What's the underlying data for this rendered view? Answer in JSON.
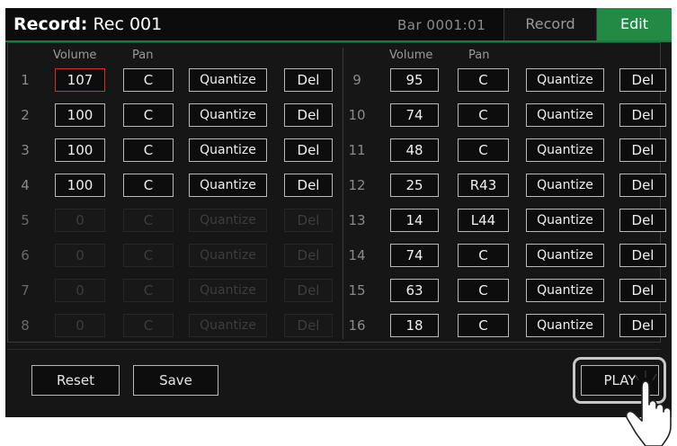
{
  "header": {
    "title_bold": "Record:",
    "title_rest": " Rec 001",
    "bar_position": "Bar 0001:01",
    "record_tab": "Record",
    "edit_tab": "Edit"
  },
  "columns": {
    "volume": "Volume",
    "pan": "Pan"
  },
  "left_tracks": [
    {
      "num": "1",
      "volume": "107",
      "pan": "C",
      "quantize": "Quantize",
      "del": "Del"
    },
    {
      "num": "2",
      "volume": "100",
      "pan": "C",
      "quantize": "Quantize",
      "del": "Del"
    },
    {
      "num": "3",
      "volume": "100",
      "pan": "C",
      "quantize": "Quantize",
      "del": "Del"
    },
    {
      "num": "4",
      "volume": "100",
      "pan": "C",
      "quantize": "Quantize",
      "del": "Del"
    },
    {
      "num": "5",
      "volume": "0",
      "pan": "C",
      "quantize": "Quantize",
      "del": "Del"
    },
    {
      "num": "6",
      "volume": "0",
      "pan": "C",
      "quantize": "Quantize",
      "del": "Del"
    },
    {
      "num": "7",
      "volume": "0",
      "pan": "C",
      "quantize": "Quantize",
      "del": "Del"
    },
    {
      "num": "8",
      "volume": "0",
      "pan": "C",
      "quantize": "Quantize",
      "del": "Del"
    }
  ],
  "right_tracks": [
    {
      "num": "9",
      "volume": "95",
      "pan": "C",
      "quantize": "Quantize",
      "del": "Del"
    },
    {
      "num": "10",
      "volume": "74",
      "pan": "C",
      "quantize": "Quantize",
      "del": "Del"
    },
    {
      "num": "11",
      "volume": "48",
      "pan": "C",
      "quantize": "Quantize",
      "del": "Del"
    },
    {
      "num": "12",
      "volume": "25",
      "pan": "R43",
      "quantize": "Quantize",
      "del": "Del"
    },
    {
      "num": "13",
      "volume": "14",
      "pan": "L44",
      "quantize": "Quantize",
      "del": "Del"
    },
    {
      "num": "14",
      "volume": "74",
      "pan": "C",
      "quantize": "Quantize",
      "del": "Del"
    },
    {
      "num": "15",
      "volume": "63",
      "pan": "C",
      "quantize": "Quantize",
      "del": "Del"
    },
    {
      "num": "16",
      "volume": "18",
      "pan": "C",
      "quantize": "Quantize",
      "del": "Del"
    }
  ],
  "buttons": {
    "reset": "Reset",
    "save": "Save",
    "play": "PLAY"
  },
  "colors": {
    "accent_green": "#228a45",
    "selected_border": "#d03030"
  }
}
